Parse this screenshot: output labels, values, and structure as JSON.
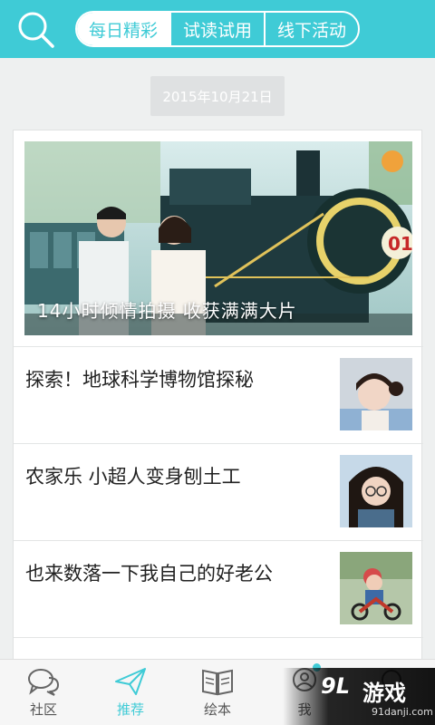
{
  "header": {
    "tabs": [
      {
        "label": "每日精彩",
        "active": true
      },
      {
        "label": "试读试用",
        "active": false
      },
      {
        "label": "线下活动",
        "active": false
      }
    ],
    "accent_color": "#3fcbd6"
  },
  "feed": {
    "date": "2015年10月21日",
    "hero": {
      "caption": "14小时倾情拍摄  收获满满大片",
      "image": "couple-with-steam-train-photo"
    },
    "articles": [
      {
        "title": "探索！地球科学博物馆探秘",
        "thumb": "girl-portrait-photo"
      },
      {
        "title": "农家乐  小超人变身刨土工",
        "thumb": "girl-with-glasses-photo"
      },
      {
        "title": "也来数落一下我自己的好老公",
        "thumb": "child-on-tricycle-photo"
      }
    ]
  },
  "bottom_nav": {
    "items": [
      {
        "label": "社区",
        "icon": "chat-bubbles-icon",
        "active": false
      },
      {
        "label": "推荐",
        "icon": "paper-plane-icon",
        "active": true
      },
      {
        "label": "绘本",
        "icon": "open-book-icon",
        "active": false
      },
      {
        "label": "我",
        "icon": "profile-icon",
        "active": false,
        "badge": true
      },
      {
        "label": "",
        "icon": "more-icon",
        "active": false
      }
    ]
  },
  "watermark": {
    "brand": "游戏",
    "logo": "9L",
    "url": "91danji.com"
  }
}
